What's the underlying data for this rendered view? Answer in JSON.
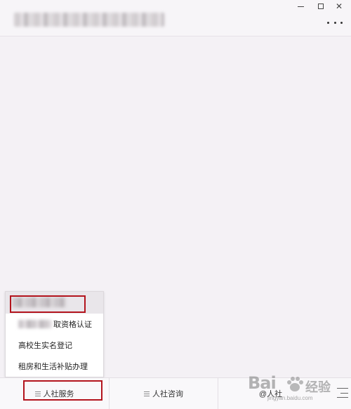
{
  "window": {
    "minimize_label": "minimize",
    "maximize_label": "maximize",
    "close_label": "close"
  },
  "popup_menu": {
    "items": [
      {
        "label": ""
      },
      {
        "label": "取资格认证"
      },
      {
        "label": "高校生实名登记"
      },
      {
        "label": "租房和生活补贴办理"
      }
    ]
  },
  "bottom_menu": {
    "tabs": [
      {
        "label": "人社服务"
      },
      {
        "label": "人社咨询"
      },
      {
        "label": "@人社"
      }
    ]
  },
  "watermark": {
    "logo": "Bai",
    "text": "经验",
    "url": "jingyan.baidu.com"
  },
  "colors": {
    "highlight": "#b3141d",
    "background": "#f4f1f5"
  }
}
